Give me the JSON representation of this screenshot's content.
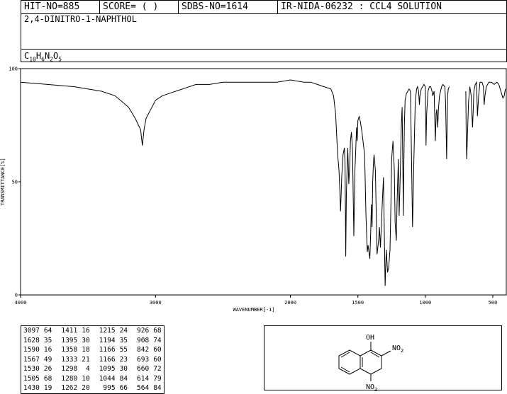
{
  "header": {
    "hit_no": "HIT-NO=885",
    "score": "SCORE= ( )",
    "sdbs_no": "SDBS-NO=1614",
    "ir_id": "IR-NIDA-06232 : CCL4 SOLUTION",
    "compound_name": "2,4-DINITRO-1-NAPHTHOL",
    "formula": {
      "c": "C",
      "c_n": "10",
      "h": "H",
      "h_n": "6",
      "n": "N",
      "n_n": "2",
      "o": "O",
      "o_n": "5"
    }
  },
  "chart_data": {
    "type": "line",
    "xlabel": "WAVENUMBER[-1]",
    "ylabel": "TRANSMITTANCE[%]",
    "xlim": [
      4000,
      400
    ],
    "ylim": [
      0,
      100
    ],
    "x_ticks": [
      4000,
      3000,
      2000,
      1500,
      1000,
      500
    ],
    "y_ticks": [
      0,
      50,
      100
    ],
    "series": [
      {
        "points": [
          [
            4000,
            94
          ],
          [
            3800,
            93
          ],
          [
            3600,
            92
          ],
          [
            3400,
            90
          ],
          [
            3300,
            88
          ],
          [
            3200,
            83
          ],
          [
            3150,
            78
          ],
          [
            3110,
            73
          ],
          [
            3097,
            66
          ],
          [
            3085,
            73
          ],
          [
            3070,
            78
          ],
          [
            3000,
            86
          ],
          [
            2950,
            88
          ],
          [
            2900,
            89
          ],
          [
            2800,
            91
          ],
          [
            2700,
            93
          ],
          [
            2600,
            93
          ],
          [
            2500,
            94
          ],
          [
            2400,
            94
          ],
          [
            2300,
            94
          ],
          [
            2200,
            94
          ],
          [
            2100,
            94
          ],
          [
            2000,
            95
          ],
          [
            1900,
            94
          ],
          [
            1850,
            94
          ],
          [
            1800,
            93
          ],
          [
            1750,
            92
          ],
          [
            1700,
            91
          ],
          [
            1680,
            88
          ],
          [
            1665,
            80
          ],
          [
            1655,
            68
          ],
          [
            1650,
            62
          ],
          [
            1640,
            55
          ],
          [
            1635,
            48
          ],
          [
            1628,
            37
          ],
          [
            1620,
            52
          ],
          [
            1610,
            62
          ],
          [
            1600,
            65
          ],
          [
            1595,
            58
          ],
          [
            1590,
            17
          ],
          [
            1585,
            45
          ],
          [
            1575,
            65
          ],
          [
            1567,
            49
          ],
          [
            1560,
            58
          ],
          [
            1555,
            68
          ],
          [
            1548,
            72
          ],
          [
            1540,
            64
          ],
          [
            1530,
            26
          ],
          [
            1522,
            55
          ],
          [
            1515,
            65
          ],
          [
            1510,
            74
          ],
          [
            1505,
            68
          ],
          [
            1500,
            77
          ],
          [
            1490,
            79
          ],
          [
            1480,
            76
          ],
          [
            1470,
            72
          ],
          [
            1450,
            62
          ],
          [
            1440,
            35
          ],
          [
            1430,
            19
          ],
          [
            1425,
            22
          ],
          [
            1420,
            20
          ],
          [
            1411,
            16
          ],
          [
            1405,
            28
          ],
          [
            1400,
            40
          ],
          [
            1395,
            30
          ],
          [
            1390,
            50
          ],
          [
            1385,
            58
          ],
          [
            1380,
            62
          ],
          [
            1370,
            55
          ],
          [
            1358,
            18
          ],
          [
            1350,
            22
          ],
          [
            1345,
            25
          ],
          [
            1340,
            30
          ],
          [
            1333,
            21
          ],
          [
            1325,
            32
          ],
          [
            1318,
            42
          ],
          [
            1310,
            52
          ],
          [
            1298,
            4
          ],
          [
            1290,
            20
          ],
          [
            1280,
            10
          ],
          [
            1272,
            12
          ],
          [
            1262,
            20
          ],
          [
            1255,
            40
          ],
          [
            1250,
            60
          ],
          [
            1240,
            68
          ],
          [
            1230,
            55
          ],
          [
            1224,
            32
          ],
          [
            1215,
            24
          ],
          [
            1210,
            40
          ],
          [
            1200,
            60
          ],
          [
            1194,
            35
          ],
          [
            1185,
            55
          ],
          [
            1178,
            75
          ],
          [
            1172,
            83
          ],
          [
            1166,
            55
          ],
          [
            1163,
            35
          ],
          [
            1160,
            55
          ],
          [
            1155,
            75
          ],
          [
            1150,
            86
          ],
          [
            1140,
            89
          ],
          [
            1130,
            90
          ],
          [
            1120,
            91
          ],
          [
            1110,
            90
          ],
          [
            1095,
            30
          ],
          [
            1085,
            60
          ],
          [
            1075,
            85
          ],
          [
            1065,
            91
          ],
          [
            1058,
            92
          ],
          [
            1050,
            90
          ],
          [
            1044,
            84
          ],
          [
            1040,
            88
          ],
          [
            1030,
            91
          ],
          [
            1020,
            92
          ],
          [
            1010,
            93
          ],
          [
            1000,
            92
          ],
          [
            995,
            66
          ],
          [
            990,
            80
          ],
          [
            980,
            90
          ],
          [
            970,
            92
          ],
          [
            960,
            92
          ],
          [
            950,
            90
          ],
          [
            945,
            88
          ],
          [
            935,
            90
          ],
          [
            926,
            68
          ],
          [
            920,
            80
          ],
          [
            915,
            82
          ],
          [
            908,
            74
          ],
          [
            903,
            82
          ],
          [
            895,
            88
          ],
          [
            880,
            92
          ],
          [
            870,
            93
          ],
          [
            855,
            92
          ],
          [
            850,
            85
          ],
          [
            842,
            60
          ],
          [
            835,
            88
          ],
          [
            830,
            91
          ],
          [
            822,
            92
          ]
        ],
        "gap_after": 822
      },
      {
        "points": [
          [
            700,
            90
          ],
          [
            697,
            70
          ],
          [
            693,
            60
          ],
          [
            688,
            70
          ],
          [
            680,
            85
          ],
          [
            670,
            92
          ],
          [
            660,
            88
          ],
          [
            655,
            80
          ],
          [
            650,
            74
          ],
          [
            645,
            82
          ],
          [
            640,
            90
          ],
          [
            630,
            93
          ],
          [
            620,
            94
          ],
          [
            614,
            79
          ],
          [
            605,
            88
          ],
          [
            595,
            94
          ],
          [
            580,
            94
          ],
          [
            570,
            92
          ],
          [
            564,
            84
          ],
          [
            558,
            88
          ],
          [
            548,
            92
          ],
          [
            530,
            94
          ],
          [
            510,
            94
          ],
          [
            490,
            93
          ],
          [
            470,
            94
          ],
          [
            455,
            93
          ],
          [
            440,
            90
          ],
          [
            425,
            87
          ],
          [
            415,
            88
          ],
          [
            410,
            90
          ],
          [
            405,
            91
          ]
        ]
      }
    ]
  },
  "peak_table": {
    "columns": [
      [
        [
          3097,
          64
        ],
        [
          1628,
          35
        ],
        [
          1590,
          16
        ],
        [
          1567,
          49
        ],
        [
          1530,
          26
        ],
        [
          1505,
          68
        ],
        [
          1430,
          19
        ]
      ],
      [
        [
          1411,
          16
        ],
        [
          1395,
          30
        ],
        [
          1358,
          18
        ],
        [
          1333,
          21
        ],
        [
          1298,
          4
        ],
        [
          1280,
          10
        ],
        [
          1262,
          20
        ]
      ],
      [
        [
          1215,
          24
        ],
        [
          1194,
          35
        ],
        [
          1166,
          55
        ],
        [
          1166,
          23
        ],
        [
          1095,
          30
        ],
        [
          1044,
          84
        ],
        [
          995,
          66
        ]
      ],
      [
        [
          926,
          68
        ],
        [
          908,
          74
        ],
        [
          842,
          60
        ],
        [
          693,
          60
        ],
        [
          660,
          72
        ],
        [
          614,
          79
        ],
        [
          564,
          84
        ]
      ]
    ]
  },
  "structure": {
    "oh_label": "OH",
    "no2_top": "NO",
    "no2_top_sub": "2",
    "no2_bottom": "NO",
    "no2_bottom_sub": "2"
  }
}
